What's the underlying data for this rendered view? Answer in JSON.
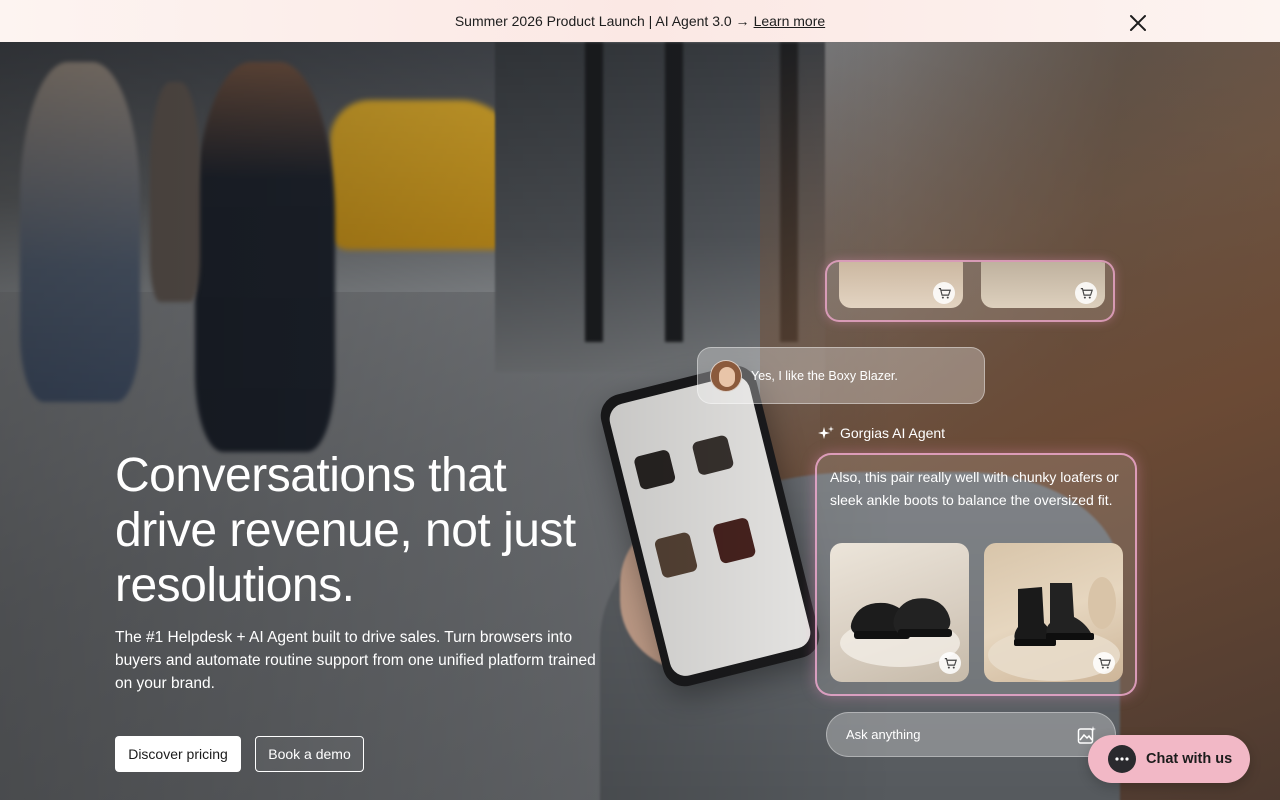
{
  "announcement": {
    "text": "Summer 2026 Product Launch | AI Agent 3.0 →",
    "link": "Learn more",
    "close_icon": "close-icon"
  },
  "hero": {
    "headline": "Conversations that\ndrive revenue, not just\nresolutions.",
    "subtext": "The #1 Helpdesk + AI Agent built to drive sales. Turn browsers into buyers and automate routine support from one unified platform trained on your brand.",
    "primary_button": "Discover pricing",
    "secondary_button": "Book a demo"
  },
  "chat_demo": {
    "user_message": "Yes, I like the Boxy Blazer.",
    "agent_name": "Gorgias AI Agent",
    "agent_message": "Also, this pair really well with chunky loafers or sleek ankle boots to balance the oversized fit.",
    "products": [
      {
        "icon": "cart-icon"
      },
      {
        "icon": "cart-icon"
      }
    ],
    "input_placeholder": "Ask anything",
    "input_icon": "image-sparkle-icon"
  },
  "chat_widget": {
    "label": "Chat with us",
    "icon": "chat-bubble-icon"
  },
  "colors": {
    "announcement_bg": "#fbe8e4",
    "accent_pink": "#f2b8c6",
    "card_glow": "#f4aad2"
  }
}
